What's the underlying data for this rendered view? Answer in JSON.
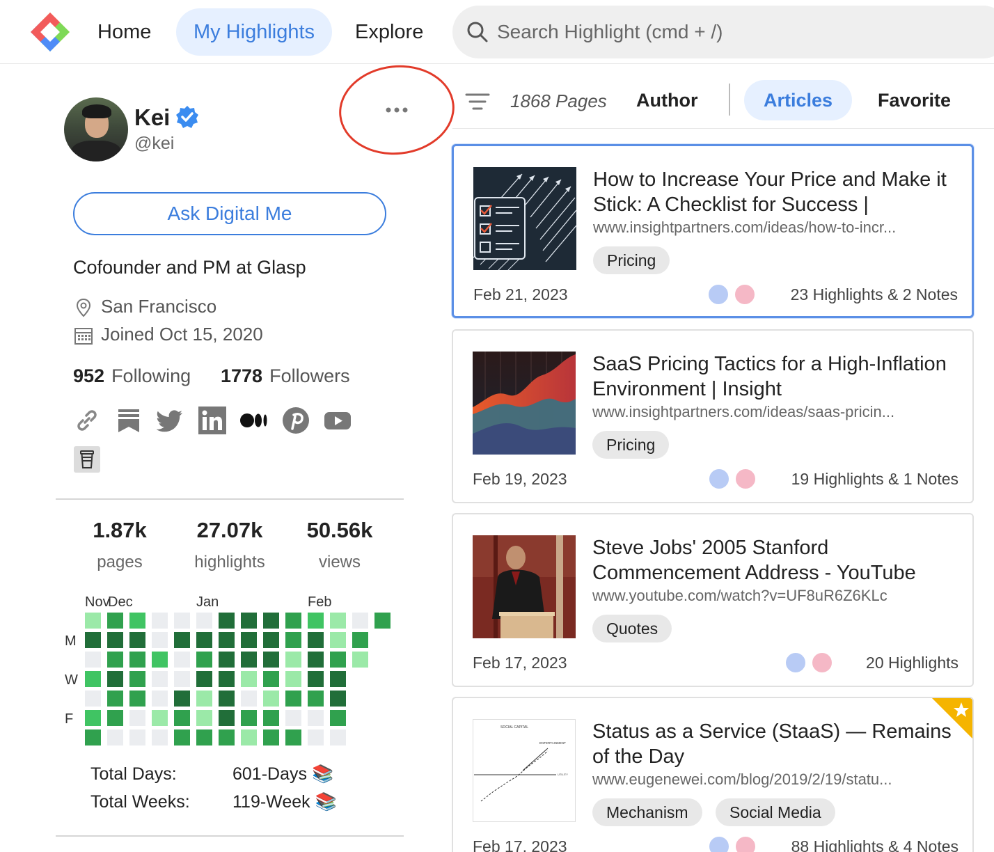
{
  "nav": {
    "items": [
      {
        "label": "Home"
      },
      {
        "label": "My Highlights"
      },
      {
        "label": "Explore"
      }
    ],
    "search_placeholder": "Search Highlight (cmd + /)"
  },
  "profile": {
    "name": "Kei",
    "handle": "@kei",
    "ask_button": "Ask Digital Me",
    "bio": "Cofounder and PM at Glasp",
    "location": "San Francisco",
    "joined": "Joined Oct 15, 2020",
    "following_count": "952",
    "following_label": "Following",
    "followers_count": "1778",
    "followers_label": "Followers",
    "social_icons": [
      "link-icon",
      "bookmark-icon",
      "twitter-icon",
      "linkedin-icon",
      "medium-icon",
      "pinterest-icon",
      "youtube-icon",
      "cup-icon"
    ]
  },
  "stats": [
    {
      "value": "1.87k",
      "label": "pages"
    },
    {
      "value": "27.07k",
      "label": "highlights"
    },
    {
      "value": "50.56k",
      "label": "views"
    }
  ],
  "heatmap": {
    "months": [
      "Nov",
      "Dec",
      "Jan",
      "Feb"
    ],
    "day_labels": [
      "M",
      "W",
      "F"
    ],
    "levels": [
      [
        1,
        3,
        2,
        0,
        0,
        0,
        4,
        4,
        4,
        3,
        2,
        1,
        0,
        3
      ],
      [
        4,
        4,
        4,
        0,
        4,
        4,
        4,
        4,
        4,
        3,
        4,
        1,
        3
      ],
      [
        0,
        3,
        3,
        2,
        0,
        3,
        4,
        4,
        4,
        1,
        4,
        3,
        1
      ],
      [
        2,
        4,
        3,
        0,
        0,
        4,
        4,
        1,
        3,
        1,
        4,
        4
      ],
      [
        0,
        3,
        3,
        0,
        4,
        1,
        4,
        0,
        1,
        3,
        3,
        4
      ],
      [
        2,
        3,
        0,
        1,
        3,
        1,
        4,
        3,
        3,
        0,
        0,
        3
      ],
      [
        3,
        0,
        0,
        0,
        3,
        3,
        3,
        1,
        3,
        3,
        0,
        0
      ]
    ],
    "colors": [
      "#ebedf0",
      "#9be9a8",
      "#40c463",
      "#30a14e",
      "#216e39"
    ]
  },
  "totals": {
    "days_label": "Total Days:",
    "days_value": "601-Days",
    "weeks_label": "Total Weeks:",
    "weeks_value": "119-Week"
  },
  "filters": {
    "pages_count": "1868 Pages",
    "tabs": [
      "Author",
      "Articles",
      "Favorite"
    ]
  },
  "articles": [
    {
      "title": "How to Increase Your Price and Make it Stick: A Checklist for Success |",
      "url": "www.insightpartners.com/ideas/how-to-incr...",
      "tags": [
        "Pricing"
      ],
      "date": "Feb 21, 2023",
      "counts": "23 Highlights & 2 Notes",
      "favorite": false
    },
    {
      "title": "SaaS Pricing Tactics for a High-Inflation Environment | Insight",
      "url": "www.insightpartners.com/ideas/saas-pricin...",
      "tags": [
        "Pricing"
      ],
      "date": "Feb 19, 2023",
      "counts": "19 Highlights & 1 Notes",
      "favorite": false
    },
    {
      "title": "Steve Jobs' 2005 Stanford Commencement Address - YouTube",
      "url": "www.youtube.com/watch?v=UF8uR6Z6KLc",
      "tags": [
        "Quotes"
      ],
      "date": "Feb 17, 2023",
      "counts": "20 Highlights",
      "favorite": false
    },
    {
      "title": "Status as a Service (StaaS) — Remains of the Day",
      "url": "www.eugenewei.com/blog/2019/2/19/statu...",
      "tags": [
        "Mechanism",
        "Social Media"
      ],
      "date": "Feb 17, 2023",
      "counts": "88 Highlights & 4 Notes",
      "favorite": true,
      "thumb_text": [
        "SOCIAL CAPITAL",
        "ENTERTAINMENT",
        "UTILITY"
      ]
    }
  ],
  "emoji": {
    "books": "📚"
  }
}
